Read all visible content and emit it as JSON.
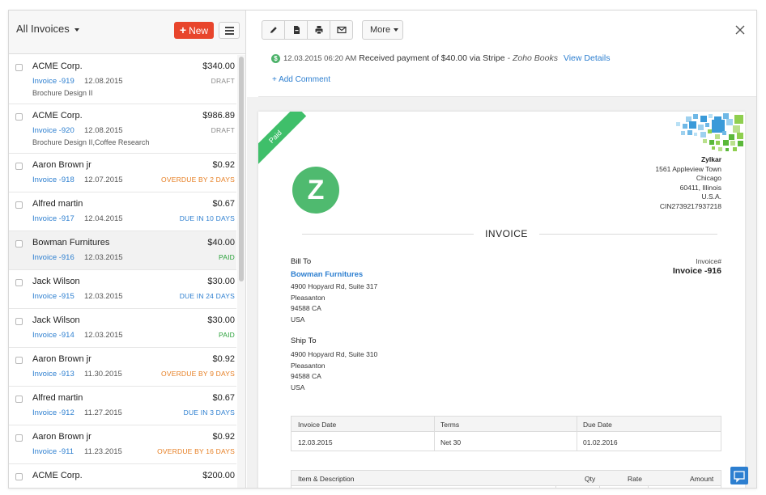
{
  "left": {
    "title": "All Invoices",
    "new_label": "New",
    "invoices": [
      {
        "customer": "ACME Corp.",
        "amount": "$340.00",
        "number": "Invoice -919",
        "date": "12.08.2015",
        "status": "DRAFT",
        "status_type": "draft",
        "description": "Brochure Design II"
      },
      {
        "customer": "ACME Corp.",
        "amount": "$986.89",
        "number": "Invoice -920",
        "date": "12.08.2015",
        "status": "DRAFT",
        "status_type": "draft",
        "description": "Brochure Design II,Coffee Research"
      },
      {
        "customer": "Aaron Brown jr",
        "amount": "$0.92",
        "number": "Invoice -918",
        "date": "12.07.2015",
        "status": "OVERDUE BY 2 DAYS",
        "status_type": "overdue"
      },
      {
        "customer": "Alfred martin",
        "amount": "$0.67",
        "number": "Invoice -917",
        "date": "12.04.2015",
        "status": "DUE IN 10 DAYS",
        "status_type": "due"
      },
      {
        "customer": "Bowman Furnitures",
        "amount": "$40.00",
        "number": "Invoice -916",
        "date": "12.03.2015",
        "status": "PAID",
        "status_type": "paid",
        "selected": true
      },
      {
        "customer": "Jack Wilson",
        "amount": "$30.00",
        "number": "Invoice -915",
        "date": "12.03.2015",
        "status": "DUE IN 24 DAYS",
        "status_type": "due"
      },
      {
        "customer": "Jack Wilson",
        "amount": "$30.00",
        "number": "Invoice -914",
        "date": "12.03.2015",
        "status": "PAID",
        "status_type": "paid"
      },
      {
        "customer": "Aaron Brown jr",
        "amount": "$0.92",
        "number": "Invoice -913",
        "date": "11.30.2015",
        "status": "OVERDUE BY 9 DAYS",
        "status_type": "overdue"
      },
      {
        "customer": "Alfred martin",
        "amount": "$0.67",
        "number": "Invoice -912",
        "date": "11.27.2015",
        "status": "DUE IN 3 DAYS",
        "status_type": "due"
      },
      {
        "customer": "Aaron Brown jr",
        "amount": "$0.92",
        "number": "Invoice -911",
        "date": "11.23.2015",
        "status": "OVERDUE BY 16 DAYS",
        "status_type": "overdue"
      },
      {
        "customer": "ACME Corp.",
        "amount": "$200.00",
        "number": "",
        "date": "",
        "status": "",
        "status_type": "draft"
      }
    ]
  },
  "toolbar": {
    "icons": [
      "pencil-icon",
      "pdf-icon",
      "print-icon",
      "mail-icon"
    ],
    "more_label": "More"
  },
  "activity": {
    "timestamp": "12.03.2015 06:20 AM",
    "message": "Received payment of $40.00 via Stripe",
    "source": "- Zoho Books",
    "link": "View Details",
    "add_comment": "+ Add Comment"
  },
  "invoice": {
    "ribbon": "Paid",
    "logo_letter": "Z",
    "company": {
      "name": "Zylkar",
      "lines": [
        "1561 Appleview Town",
        "Chicago",
        "60411, Illinois",
        "U.S.A.",
        "CIN2739217937218"
      ]
    },
    "title": "INVOICE",
    "bill_to_label": "Bill To",
    "bill_to_name": "Bowman Furnitures",
    "bill_to_lines": [
      "4900 Hopyard Rd, Suite 317",
      "Pleasanton",
      "94588 CA",
      "USA"
    ],
    "ship_to_label": "Ship To",
    "ship_to_lines": [
      "4900 Hopyard Rd, Suite 310",
      "Pleasanton",
      "94588 CA",
      "USA"
    ],
    "number_label": "Invoice#",
    "number": "Invoice -916",
    "terms_headers": [
      "Invoice Date",
      "Terms",
      "Due Date"
    ],
    "terms_values": [
      "12.03.2015",
      "Net 30",
      "01.02.2016"
    ],
    "item_headers": [
      "Item & Description",
      "Qty",
      "Rate",
      "Amount"
    ]
  },
  "colors": {
    "accent": "#2d7fd0",
    "new_button": "#e8452c",
    "paid": "#2aa13a",
    "overdue": "#e67e22",
    "logo": "#4fba6f"
  }
}
